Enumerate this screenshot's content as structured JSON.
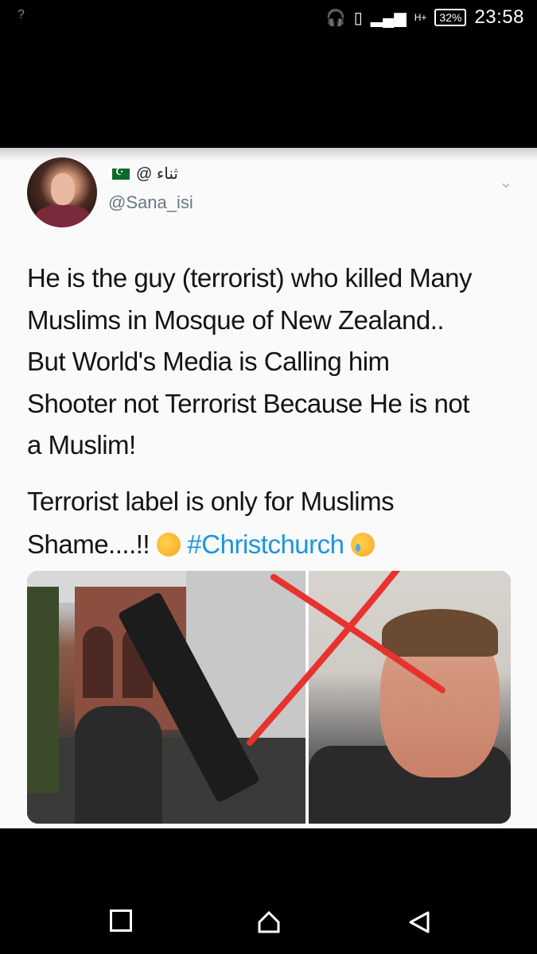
{
  "status_bar": {
    "left_indicator": "?",
    "network": "H+",
    "battery": "32%",
    "time": "23:58"
  },
  "tweet": {
    "author_name": "@ ثناء",
    "author_handle": "@Sana_isi",
    "text_line1": "He is the guy (terrorist) who killed Many",
    "text_line2": "Muslims in Mosque of New Zealand..",
    "text_line3": "But World's Media is Calling him",
    "text_line4": "Shooter not Terrorist Because He is not",
    "text_line5": "a Muslim!",
    "text2_line1": "Terrorist label is only for Muslims",
    "text2_prefix": "Shame....!! ",
    "hashtag": "#Christchurch"
  },
  "icons": {
    "headphones": "headphones-icon",
    "vibrate": "vibrate-icon",
    "signal": "signal-icon",
    "chevron": "chevron-down-icon",
    "flag": "pakistan-flag-icon"
  },
  "colors": {
    "hashtag": "#1b95e0",
    "handle": "#6b7784",
    "cross": "#e8322e"
  }
}
